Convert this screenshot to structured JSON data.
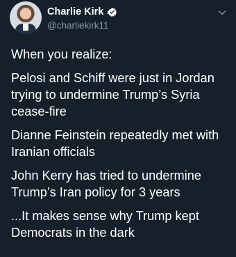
{
  "author": {
    "display_name": "Charlie Kirk",
    "handle": "@charliekirk11",
    "verified": true
  },
  "menu_icon": "chevron-down-icon",
  "tweet": {
    "paragraphs": [
      "When you realize:",
      "Pelosi and Schiff were just in Jordan\ntrying to undermine Trump’s Syria\ncease-fire",
      "Dianne Feinstein repeatedly met with\nIranian officials",
      "John Kerry has tried to undermine\nTrump’s Iran policy for 3 years",
      "...It makes sense why Trump kept\nDemocrats in the dark"
    ]
  },
  "colors": {
    "background": "#15202b",
    "text": "#ffffff",
    "secondary_text": "#8899a6",
    "verified": "#ffffff"
  }
}
